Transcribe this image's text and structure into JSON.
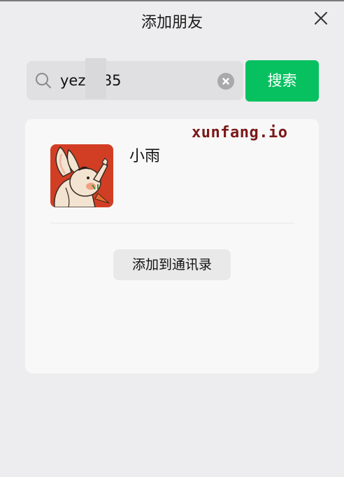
{
  "dialog": {
    "title": "添加朋友",
    "close_icon": "close-icon"
  },
  "search": {
    "value": "yezz685",
    "search_icon": "search-icon",
    "clear_icon": "clear-icon",
    "button_label": "搜索"
  },
  "result": {
    "name": "小雨",
    "add_button_label": "添加到通讯录",
    "watermark": "xunfang.io"
  },
  "colors": {
    "accent": "#07c160",
    "background": "#ededef",
    "card": "#f8f8f8",
    "watermark": "#7a1919"
  }
}
